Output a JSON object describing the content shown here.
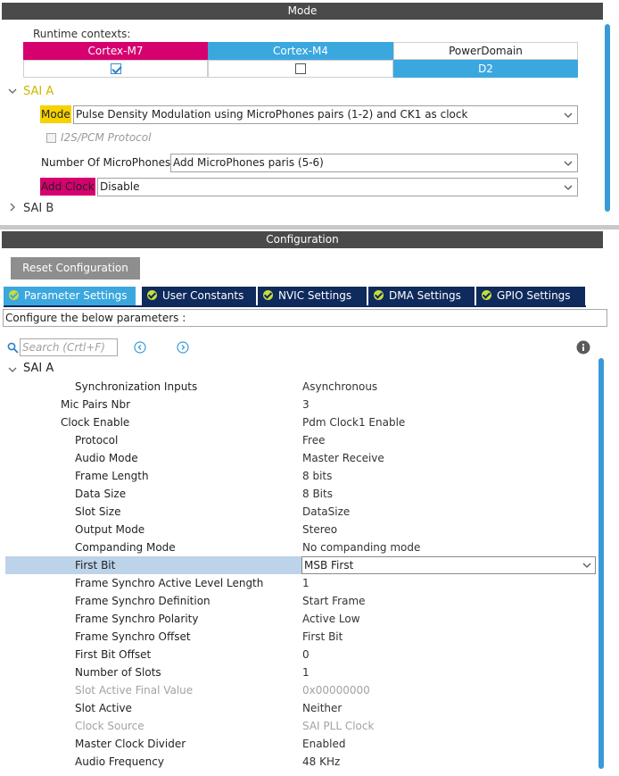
{
  "mode_panel": {
    "title": "Mode",
    "runtime_contexts_label": "Runtime contexts:",
    "contexts": {
      "headers": [
        "Cortex-M7",
        "Cortex-M4",
        "PowerDomain"
      ],
      "cortex_m7_checked": true,
      "cortex_m4_checked": false,
      "power_domain_value": "D2"
    },
    "sai_a": {
      "label": "SAI A",
      "expanded": true,
      "mode_label": "Mode",
      "mode_value": "Pulse Density Modulation using MicroPhones pairs (1-2) and CK1 as clock",
      "i2s_label": "I2S/PCM Protocol",
      "mics_label": "Number Of MicroPhones",
      "mics_value": "Add MicroPhones paris (5-6)",
      "clock_label": "Add Clock",
      "clock_value": "Disable"
    },
    "sai_b": {
      "label": "SAI B",
      "expanded": false
    }
  },
  "config_panel": {
    "title": "Configuration",
    "reset_button": "Reset Configuration",
    "tabs": [
      {
        "label": "Parameter Settings",
        "active": true
      },
      {
        "label": "User Constants",
        "active": false
      },
      {
        "label": "NVIC Settings",
        "active": false
      },
      {
        "label": "DMA Settings",
        "active": false
      },
      {
        "label": "GPIO Settings",
        "active": false
      }
    ],
    "description": "Configure the below parameters :",
    "search_placeholder": "Search (Crtl+F)",
    "group_label": "SAI A",
    "params": [
      {
        "name": "Synchronization Inputs",
        "value": "Asynchronous",
        "indent": 2
      },
      {
        "name": "Mic Pairs Nbr",
        "value": "3",
        "indent": 1
      },
      {
        "name": "Clock Enable",
        "value": "Pdm Clock1 Enable",
        "indent": 1
      },
      {
        "name": "Protocol",
        "value": "Free",
        "indent": 2
      },
      {
        "name": "Audio Mode",
        "value": "Master Receive",
        "indent": 2
      },
      {
        "name": "Frame Length",
        "value": "8 bits",
        "indent": 2
      },
      {
        "name": "Data Size",
        "value": "8 Bits",
        "indent": 2
      },
      {
        "name": "Slot Size",
        "value": "DataSize",
        "indent": 2
      },
      {
        "name": "Output Mode",
        "value": "Stereo",
        "indent": 2
      },
      {
        "name": "Companding Mode",
        "value": "No companding mode",
        "indent": 2
      },
      {
        "name": "First Bit",
        "value": "MSB First",
        "indent": 2,
        "selected": true
      },
      {
        "name": "Frame Synchro Active Level Length",
        "value": "1",
        "indent": 2
      },
      {
        "name": "Frame Synchro Definition",
        "value": "Start Frame",
        "indent": 2
      },
      {
        "name": "Frame Synchro Polarity",
        "value": "Active Low",
        "indent": 2
      },
      {
        "name": "Frame Synchro Offset",
        "value": "First Bit",
        "indent": 2
      },
      {
        "name": "First Bit Offset",
        "value": "0",
        "indent": 2
      },
      {
        "name": "Number of Slots",
        "value": "1",
        "indent": 2
      },
      {
        "name": "Slot Active Final Value",
        "value": "0x00000000",
        "indent": 2,
        "disabled": true
      },
      {
        "name": "Slot Active",
        "value": "Neither",
        "indent": 2
      },
      {
        "name": "Clock Source",
        "value": "SAI PLL Clock",
        "indent": 2,
        "disabled": true
      },
      {
        "name": "Master Clock Divider",
        "value": "Enabled",
        "indent": 2
      },
      {
        "name": "Audio Frequency",
        "value": "48 KHz",
        "indent": 2
      }
    ]
  },
  "colors": {
    "header_bg": "#4a4a4a",
    "cortex_m7": "#d6006f",
    "cortex_m4": "#3ba7df",
    "tab_bg": "#0f2a5c",
    "tab_active": "#3ba7df",
    "selected_row": "#bdd3ea",
    "sai_a_label": "#c9b800"
  },
  "icons": {
    "tab_status": "check-circle-icon",
    "search": "search-icon",
    "prev": "chevron-left-circle-icon",
    "next": "chevron-right-circle-icon",
    "info": "info-icon"
  }
}
